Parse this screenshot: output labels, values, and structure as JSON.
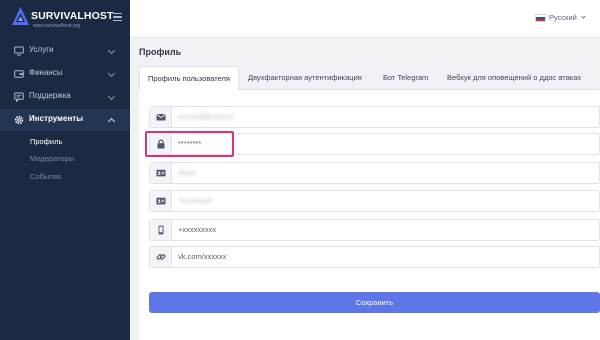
{
  "brand": {
    "name": "SURVIVALHOST",
    "subtitle": "www.survivalhost.org"
  },
  "sidebar": {
    "items": [
      {
        "label": "Услуги",
        "icon": "monitor-icon"
      },
      {
        "label": "Финансы",
        "icon": "wallet-icon"
      },
      {
        "label": "Поддержка",
        "icon": "support-icon"
      },
      {
        "label": "Инструменты",
        "icon": "settings-icon",
        "active": true
      }
    ],
    "sub_items": [
      "Профиль",
      "Модераторы",
      "События"
    ]
  },
  "topbar": {
    "language": "Русский"
  },
  "page": {
    "title": "Профиль"
  },
  "tabs": [
    "Профиль пользователя",
    "Двухфакторная аутентификация",
    "Бот Telegram",
    "Вебхук для оповещений о ддос атаках"
  ],
  "fields": [
    {
      "icon": "mail-icon",
      "value": "survival@mail.ru",
      "blurred": true
    },
    {
      "icon": "lock-icon",
      "value": "********",
      "blurred": false
    },
    {
      "icon": "id-card-icon",
      "value": "Иван",
      "blurred": true
    },
    {
      "icon": "id-card-icon",
      "value": "Тестовый",
      "blurred": true
    },
    {
      "icon": "phone-icon",
      "value": "+xxxxxxxxx",
      "blurred": false
    },
    {
      "icon": "link-icon",
      "value": "vk.com/xxxxxx",
      "blurred": false
    }
  ],
  "save_label": "Сохранить",
  "colors": {
    "sidebar": "#1b2942",
    "accent": "#5d76e8",
    "highlight": "#d63384"
  }
}
